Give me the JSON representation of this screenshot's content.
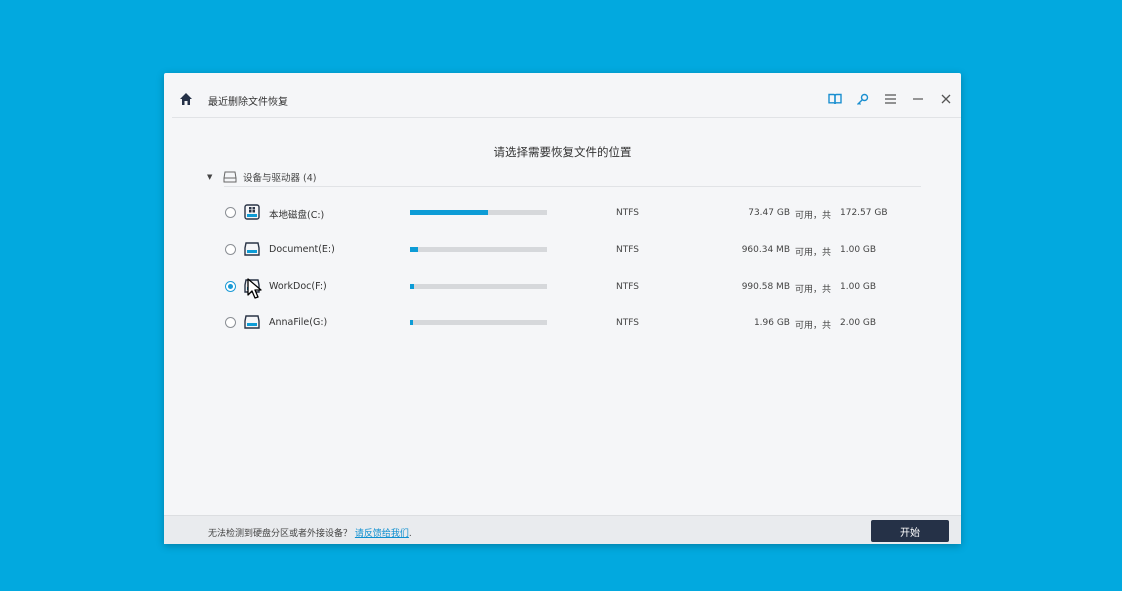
{
  "window": {
    "title": "最近删除文件恢复",
    "toolbar": {
      "icons": [
        "home-icon",
        "book-icon",
        "key-icon",
        "menu-icon",
        "minimize-icon",
        "close-icon"
      ]
    }
  },
  "main": {
    "heading": "请选择需要恢复文件的位置",
    "group": {
      "label": "设备与驱动器 (4)",
      "drives": [
        {
          "name": "本地磁盘(C:)",
          "fs": "NTFS",
          "free": "73.47 GB",
          "avail_label": "可用，共",
          "total": "172.57 GB",
          "used_fraction": 0.57,
          "selected": false,
          "icon": "system-drive-icon"
        },
        {
          "name": "Document(E:)",
          "fs": "NTFS",
          "free": "960.34 MB",
          "avail_label": "可用，共",
          "total": "1.00 GB",
          "used_fraction": 0.06,
          "selected": false,
          "icon": "drive-icon"
        },
        {
          "name": "WorkDoc(F:)",
          "fs": "NTFS",
          "free": "990.58 MB",
          "avail_label": "可用，共",
          "total": "1.00 GB",
          "used_fraction": 0.03,
          "selected": true,
          "icon": "drive-icon"
        },
        {
          "name": "AnnaFile(G:)",
          "fs": "NTFS",
          "free": "1.96 GB",
          "avail_label": "可用，共",
          "total": "2.00 GB",
          "used_fraction": 0.02,
          "selected": false,
          "icon": "drive-icon"
        }
      ]
    }
  },
  "footer": {
    "text": "无法检测到硬盘分区或者外接设备？",
    "link": "请反馈给我们",
    "link_suffix": ".",
    "start_label": "开始"
  },
  "colors": {
    "background": "#02a9df",
    "accent": "#0d9cd6",
    "start_button": "#253147"
  }
}
